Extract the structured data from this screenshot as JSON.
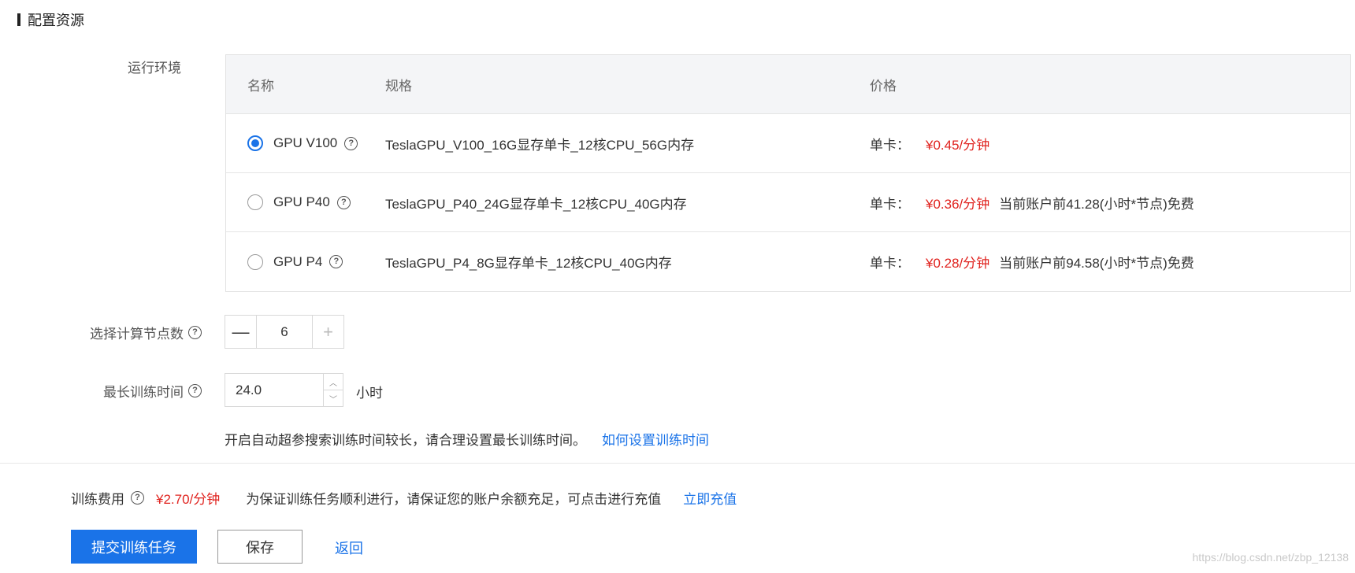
{
  "section": {
    "title": "配置资源"
  },
  "env": {
    "label": "运行环境",
    "headers": {
      "name": "名称",
      "spec": "规格",
      "price": "价格"
    },
    "rows": [
      {
        "name": "GPU V100",
        "spec": "TeslaGPU_V100_16G显存单卡_12核CPU_56G内存",
        "price_label": "单卡：",
        "price": "¥0.45/分钟",
        "note": "",
        "selected": true
      },
      {
        "name": "GPU P40",
        "spec": "TeslaGPU_P40_24G显存单卡_12核CPU_40G内存",
        "price_label": "单卡：",
        "price": "¥0.36/分钟",
        "note": "当前账户前41.28(小时*节点)免费",
        "selected": false
      },
      {
        "name": "GPU P4",
        "spec": "TeslaGPU_P4_8G显存单卡_12核CPU_40G内存",
        "price_label": "单卡：",
        "price": "¥0.28/分钟",
        "note": "当前账户前94.58(小时*节点)免费",
        "selected": false
      }
    ]
  },
  "nodes": {
    "label": "选择计算节点数",
    "value": "6",
    "minus": "—",
    "plus": "+"
  },
  "max_time": {
    "label": "最长训练时间",
    "value": "24.0",
    "unit": "小时"
  },
  "tip": {
    "text": "开启自动超参搜索训练时间较长，请合理设置最长训练时间。",
    "link": "如何设置训练时间"
  },
  "fee": {
    "label": "训练费用",
    "value": "¥2.70/分钟",
    "notice": "为保证训练任务顺利进行，请保证您的账户余额充足，可点击进行充值",
    "recharge_link": "立即充值"
  },
  "actions": {
    "submit": "提交训练任务",
    "save": "保存",
    "back": "返回"
  },
  "watermark": "https://blog.csdn.net/zbp_12138",
  "colors": {
    "accent": "#1a73e8",
    "price_red": "#e0231f"
  },
  "icons": {
    "help": "question-circle-icon",
    "radio_on": "radio-checked",
    "radio_off": "radio-unchecked"
  }
}
